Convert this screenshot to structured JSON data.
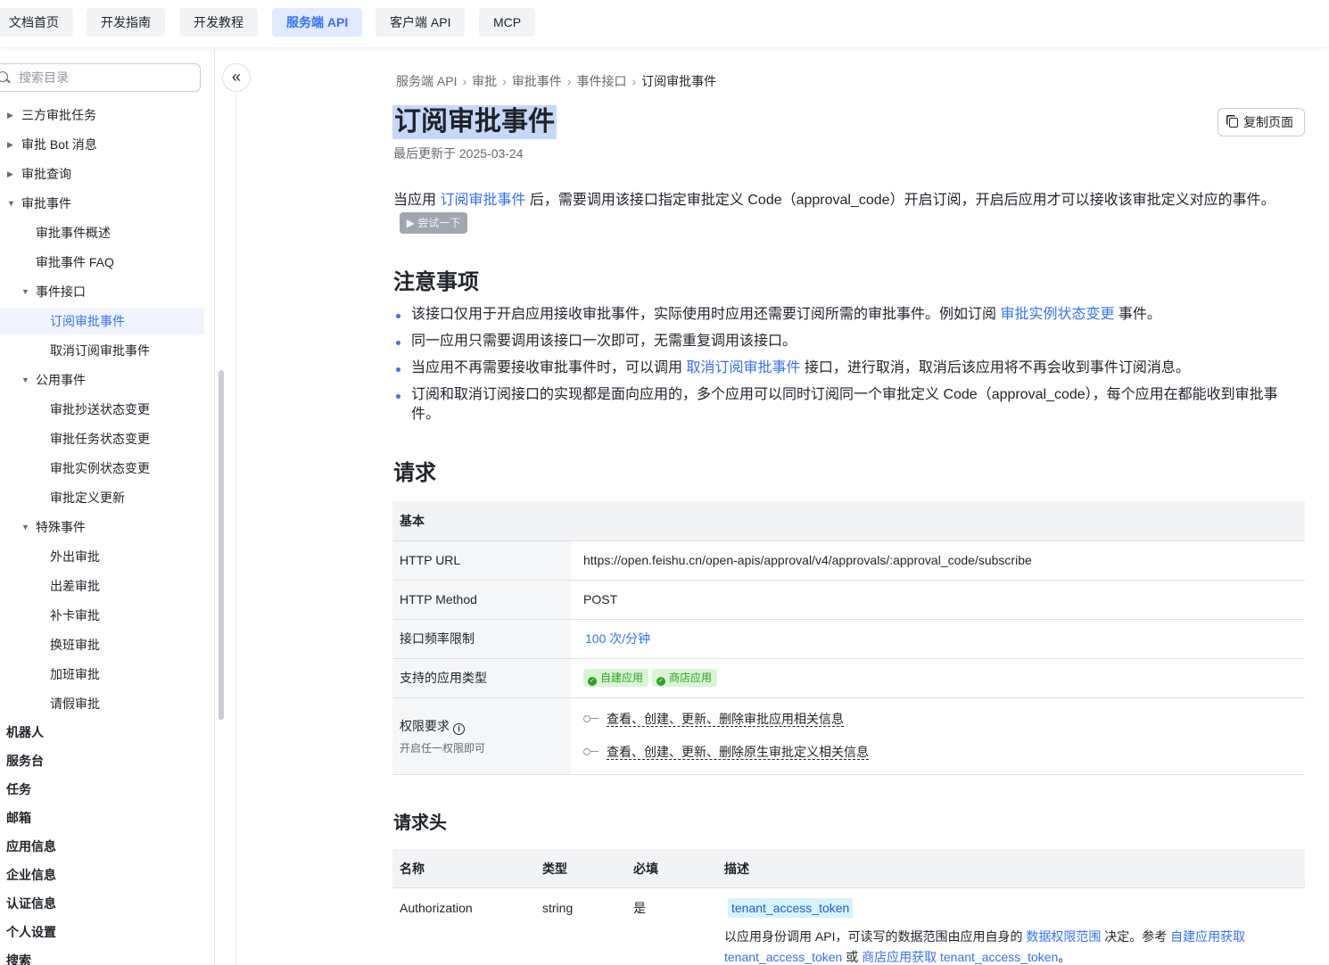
{
  "topnav": {
    "tabs": [
      {
        "label": "文档首页",
        "active": false
      },
      {
        "label": "开发指南",
        "active": false
      },
      {
        "label": "开发教程",
        "active": false
      },
      {
        "label": "服务端 API",
        "active": true
      },
      {
        "label": "客户端 API",
        "active": false
      },
      {
        "label": "MCP",
        "active": false
      }
    ]
  },
  "sidebar": {
    "search_placeholder": "搜索目录",
    "items": [
      {
        "label": "三方审批任务",
        "expanded": false
      },
      {
        "label": "审批 Bot 消息",
        "expanded": false
      },
      {
        "label": "审批查询",
        "expanded": false
      },
      {
        "label": "审批事件",
        "expanded": true
      },
      {
        "label": "审批事件概述"
      },
      {
        "label": "审批事件 FAQ"
      },
      {
        "label": "事件接口",
        "expanded": true
      },
      {
        "label": "订阅审批事件",
        "active": true
      },
      {
        "label": "取消订阅审批事件"
      },
      {
        "label": "公用事件",
        "expanded": true
      },
      {
        "label": "审批抄送状态变更"
      },
      {
        "label": "审批任务状态变更"
      },
      {
        "label": "审批实例状态变更"
      },
      {
        "label": "审批定义更新"
      },
      {
        "label": "特殊事件",
        "expanded": true
      },
      {
        "label": "外出审批"
      },
      {
        "label": "出差审批"
      },
      {
        "label": "补卡审批"
      },
      {
        "label": "换班审批"
      },
      {
        "label": "加班审批"
      },
      {
        "label": "请假审批"
      }
    ],
    "top_items": [
      "机器人",
      "服务台",
      "任务",
      "邮箱",
      "应用信息",
      "企业信息",
      "认证信息",
      "个人设置",
      "搜索"
    ]
  },
  "collapse_icon": "double-chevron-left-icon",
  "breadcrumb": [
    "服务端 API",
    "审批",
    "审批事件",
    "事件接口",
    "订阅审批事件"
  ],
  "page": {
    "title": "订阅审批事件",
    "updated": "最后更新于 2025-03-24",
    "copy_button": "复制页面",
    "intro_before": "当应用 ",
    "intro_link": "订阅审批事件",
    "intro_after": " 后，需要调用该接口指定审批定义 Code（approval_code）开启订阅，开启后应用才可以接收该审批定义对应的事件。",
    "try_button": "▶ 尝试一下"
  },
  "notes": {
    "title": "注意事项",
    "b1_before": "该接口仅用于开启应用接收审批事件，实际使用时应用还需要订阅所需的审批事件。例如订阅 ",
    "b1_link": "审批实例状态变更",
    "b1_after": " 事件。",
    "b2": "同一应用只需要调用该接口一次即可，无需重复调用该接口。",
    "b3_before": "当应用不再需要接收审批事件时，可以调用 ",
    "b3_link": "取消订阅审批事件",
    "b3_after": " 接口，进行取消，取消后该应用将不再会收到事件订阅消息。",
    "b4": "订阅和取消订阅接口的实现都是面向应用的，多个应用可以同时订阅同一个审批定义 Code（approval_code），每个应用在都能收到审批事件。"
  },
  "request": {
    "title": "请求",
    "table_header": "基本",
    "url_label": "HTTP URL",
    "url_value": "https://open.feishu.cn/open-apis/approval/v4/approvals/:approval_code/subscribe",
    "method_label": "HTTP Method",
    "method_value": "POST",
    "rate_label": "接口频率限制",
    "rate_value": "100 次/分钟",
    "apptype_label": "支持的应用类型",
    "apptype_tags": [
      "自建应用",
      "商店应用"
    ],
    "perm_label": "权限要求",
    "perm_note": "开启任一权限即可",
    "perms": [
      "查看、创建、更新、删除审批应用相关信息",
      "查看、创建、更新、删除原生审批定义相关信息"
    ]
  },
  "headers": {
    "title": "请求头",
    "columns": [
      "名称",
      "类型",
      "必填",
      "描述"
    ],
    "rows": [
      {
        "name": "Authorization",
        "type": "string",
        "required": "是",
        "token": "tenant_access_token",
        "desc_1": "以应用身份调用 API，可读写的数据范围由应用自身的 ",
        "desc_link1": "数据权限范围",
        "desc_2": " 决定。参考 ",
        "desc_link2": "自建应用获取",
        "desc_link2b": "tenant_access_token",
        "desc_3": " 或 ",
        "desc_link3": "商店应用获取 tenant_access_token",
        "desc_4": "。"
      }
    ]
  },
  "colors": {
    "accent": "#3370ff",
    "title_highlight": "#c6d8fa",
    "tag_green": "#2ea121"
  }
}
